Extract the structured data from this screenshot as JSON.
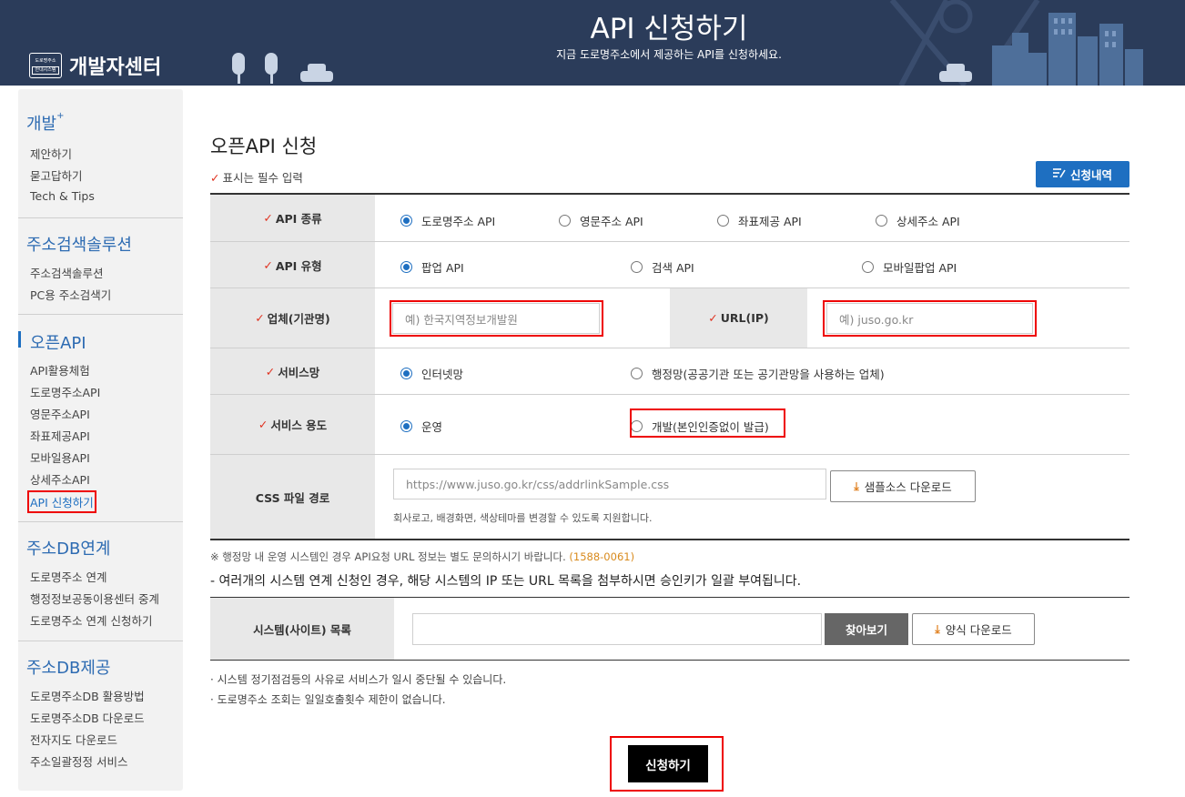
{
  "header": {
    "logo_badge_line1": "도로명주소",
    "logo_badge_line2": "안내시스템",
    "logo_text": "개발자센터",
    "title": "API 신청하기",
    "subtitle": "지금 도로명주소에서 제공하는 API를 신청하세요."
  },
  "sidebar": {
    "groups": [
      {
        "title": "개발",
        "suffix": "+",
        "items": [
          "제안하기",
          "묻고답하기",
          "Tech & Tips"
        ]
      },
      {
        "title": "주소검색솔루션",
        "items": [
          "주소검색솔루션",
          "PC용 주소검색기"
        ]
      },
      {
        "title": "오픈API",
        "items": [
          "API활용체험",
          "도로명주소API",
          "영문주소API",
          "좌표제공API",
          "모바일용API",
          "상세주소API",
          "API 신청하기"
        ]
      },
      {
        "title": "주소DB연계",
        "items": [
          "도로명주소 연계",
          "행정정보공동이용센터 중계",
          "도로명주소 연계 신청하기"
        ]
      },
      {
        "title": "주소DB제공",
        "items": [
          "도로명주소DB 활용방법",
          "도로명주소DB 다운로드",
          "전자지도 다운로드",
          "주소일괄정정 서비스"
        ]
      }
    ]
  },
  "main": {
    "title": "오픈API 신청",
    "required_check": "✓",
    "required_note": "표시는 필수 입력",
    "history_button": "신청내역",
    "rows": {
      "api_kind": {
        "label": "API 종류",
        "options": [
          "도로명주소 API",
          "영문주소 API",
          "좌표제공 API",
          "상세주소 API"
        ],
        "selected": "도로명주소 API"
      },
      "api_type": {
        "label": "API 유형",
        "options": [
          "팝업 API",
          "검색 API",
          "모바일팝업 API"
        ],
        "selected": "팝업 API"
      },
      "company": {
        "label": "업체(기관명)",
        "placeholder": "예) 한국지역정보개발원",
        "url_label": "URL(IP)",
        "url_placeholder": "예) juso.go.kr"
      },
      "network": {
        "label": "서비스망",
        "options": [
          "인터넷망",
          "행정망(공공기관 또는 공기관망을 사용하는 업체)"
        ],
        "selected": "인터넷망"
      },
      "usage": {
        "label": "서비스 용도",
        "options": [
          "운영",
          "개발(본인인증없이 발급)"
        ],
        "selected": "운영"
      },
      "css": {
        "label": "CSS 파일 경로",
        "value": "https://www.juso.go.kr/css/addrlinkSample.css",
        "download_button": "샘플소스 다운로드",
        "help": "회사로고, 배경화면, 색상테마를 변경할 수 있도록 지원합니다."
      }
    },
    "notice_admin": "※ 행정망 내 운영 시스템인 경우 API요청 URL 정보는 별도 문의하시기 바랍니다.",
    "notice_phone": "(1588-0061)",
    "notice_multi": "- 여러개의 시스템 연계 신청인 경우, 해당 시스템의 IP 또는 URL 목록을 첨부하시면 승인키가 일괄 부여됩니다.",
    "system_list": {
      "label": "시스템(사이트) 목록",
      "value": "",
      "browse_button": "찾아보기",
      "download_button": "양식 다운로드"
    },
    "bullets": [
      "· 시스템 정기점검등의 사유로 서비스가 일시 중단될 수 있습니다.",
      "· 도로명주소 조회는 일일호출횟수 제한이 없습니다."
    ],
    "submit_button": "신청하기"
  },
  "colors": {
    "header_bg": "#2b3c5a",
    "accent": "#1e6fc1",
    "check": "#e0301e",
    "highlight_box": "#e00000"
  }
}
